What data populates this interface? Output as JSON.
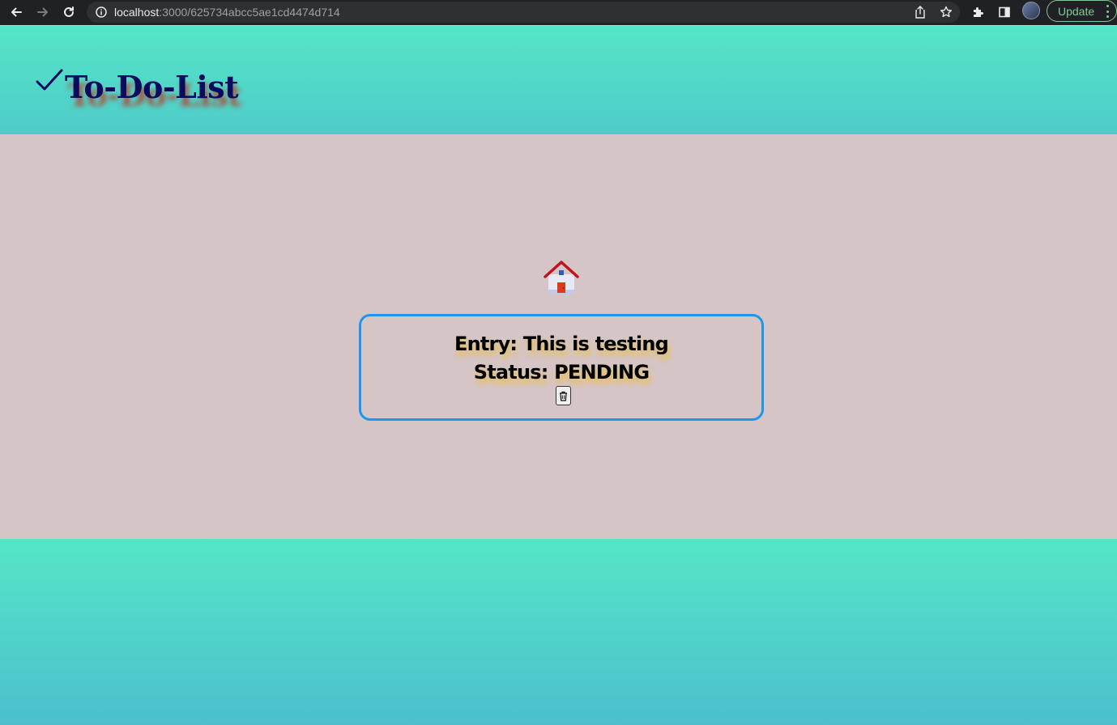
{
  "browser": {
    "url_host": "localhost",
    "url_path": ":3000/625734abcc5ae1cd4474d714",
    "update_label": "Update"
  },
  "app": {
    "title": "To-Do-List"
  },
  "entry": {
    "entry_line": "Entry: This is testing",
    "status_line": "Status: PENDING"
  },
  "colors": {
    "header_gradient_top": "#55e6c6",
    "header_gradient_bottom": "#4ecbca",
    "main_background": "#d6c5c6",
    "card_border": "#1e96f0",
    "title_color": "#0a0a5e",
    "title_shadow": "#c82814",
    "entry_text_shadow": "#ebbe46"
  },
  "icons": {
    "check": "check-icon",
    "home": "house-icon",
    "delete": "trash-icon"
  }
}
